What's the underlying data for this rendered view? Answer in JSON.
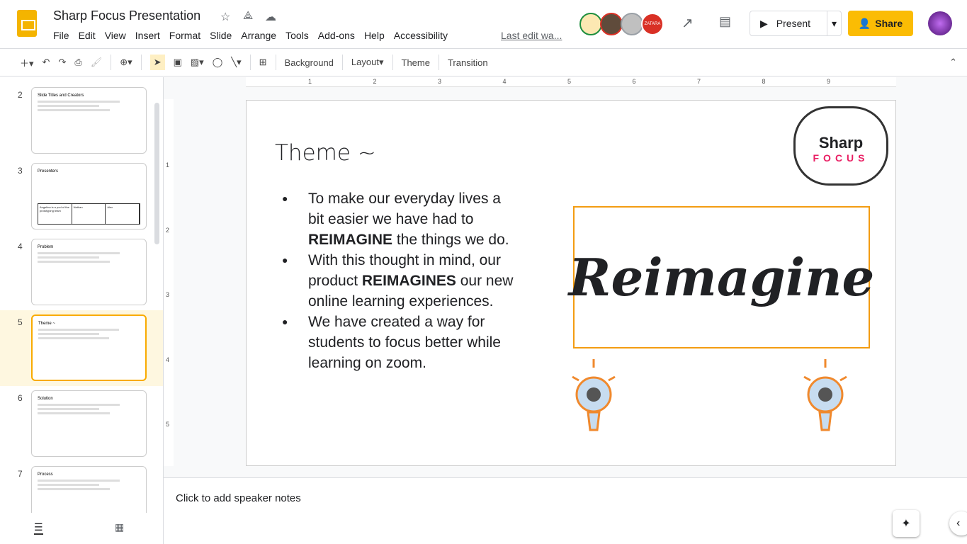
{
  "app": {
    "title": "Sharp Focus Presentation",
    "last_edit": "Last edit wa...",
    "menu": [
      "File",
      "Edit",
      "View",
      "Insert",
      "Format",
      "Slide",
      "Arrange",
      "Tools",
      "Add-ons",
      "Help",
      "Accessibility"
    ],
    "present_label": "Present",
    "share_label": "Share",
    "accent": "#fbbc04"
  },
  "collaborators": [
    {
      "color": "#1e8e3e"
    },
    {
      "color": "#d93025"
    },
    {
      "color": "#9aa0a6"
    },
    {
      "color": "#d93025",
      "label": "ZATARA"
    }
  ],
  "toolbar": {
    "background": "Background",
    "layout": "Layout",
    "theme": "Theme",
    "transition": "Transition"
  },
  "ruler": {
    "h": [
      "1",
      "2",
      "3",
      "4",
      "5",
      "6",
      "7",
      "8",
      "9"
    ],
    "v": [
      "1",
      "2",
      "3",
      "4",
      "5"
    ]
  },
  "filmstrip": [
    {
      "num": "2",
      "title": "Slide Titles and Creators"
    },
    {
      "num": "3",
      "title": "Presenters",
      "cells": [
        "Angelina is a pod of the prototyping team",
        "Nathan",
        "Alex"
      ]
    },
    {
      "num": "4",
      "title": "Problem"
    },
    {
      "num": "5",
      "title": "Theme ~"
    },
    {
      "num": "6",
      "title": "Solution"
    },
    {
      "num": "7",
      "title": "Process"
    }
  ],
  "slide": {
    "title": "Theme ~",
    "image_text": "Reimagine",
    "logo_text": "Sharp",
    "logo_sub": "FOCUS",
    "bullets": [
      {
        "pre": "To make our everyday lives a bit easier we have had to ",
        "bold": "REIMAGINE",
        "post": "  the things we do."
      },
      {
        "pre": "With this thought in mind, our product ",
        "bold": "REIMAGINES",
        "post": " our new online learning experiences."
      },
      {
        "pre": "We have created a way for students to focus better while learning on zoom.",
        "bold": "",
        "post": ""
      }
    ]
  },
  "notes": {
    "placeholder": "Click to add speaker notes"
  }
}
